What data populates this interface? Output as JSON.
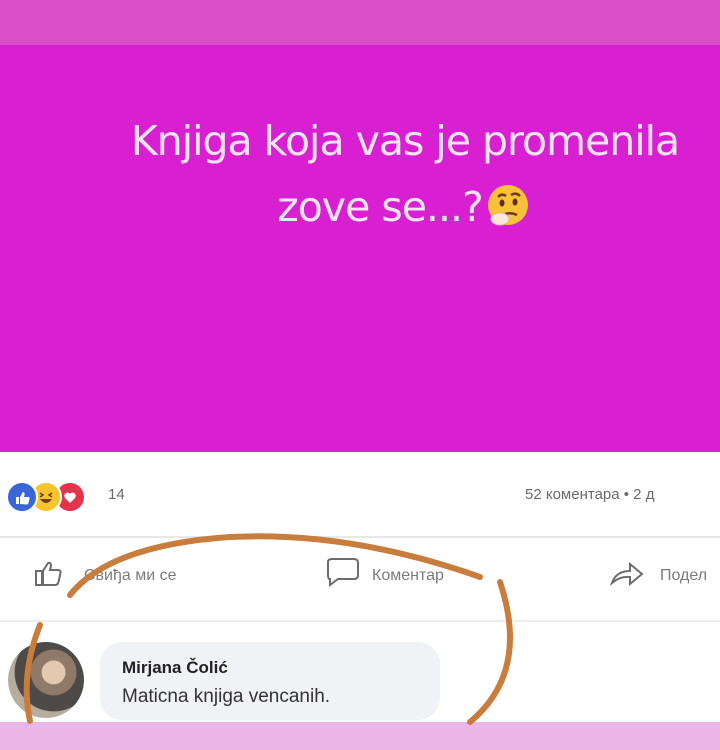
{
  "post": {
    "line1": "Knjiga koja vas je promenila",
    "line2": "zove se...?",
    "emoji": "thinking-face-icon"
  },
  "stats": {
    "reactions": [
      "like-icon",
      "haha-icon",
      "love-icon"
    ],
    "reaction_count": "14",
    "comments_label": "52 коментара • 2 д"
  },
  "actions": {
    "like": "Свиђа ми се",
    "comment": "Коментар",
    "share": "Подел"
  },
  "comment": {
    "author": "Mirjana Čolić",
    "text": "Maticna knjiga vencanih."
  },
  "colors": {
    "post_background": "#d91fd2",
    "top_band": "#d84fc6",
    "annotation_stroke": "#c87d3c"
  }
}
